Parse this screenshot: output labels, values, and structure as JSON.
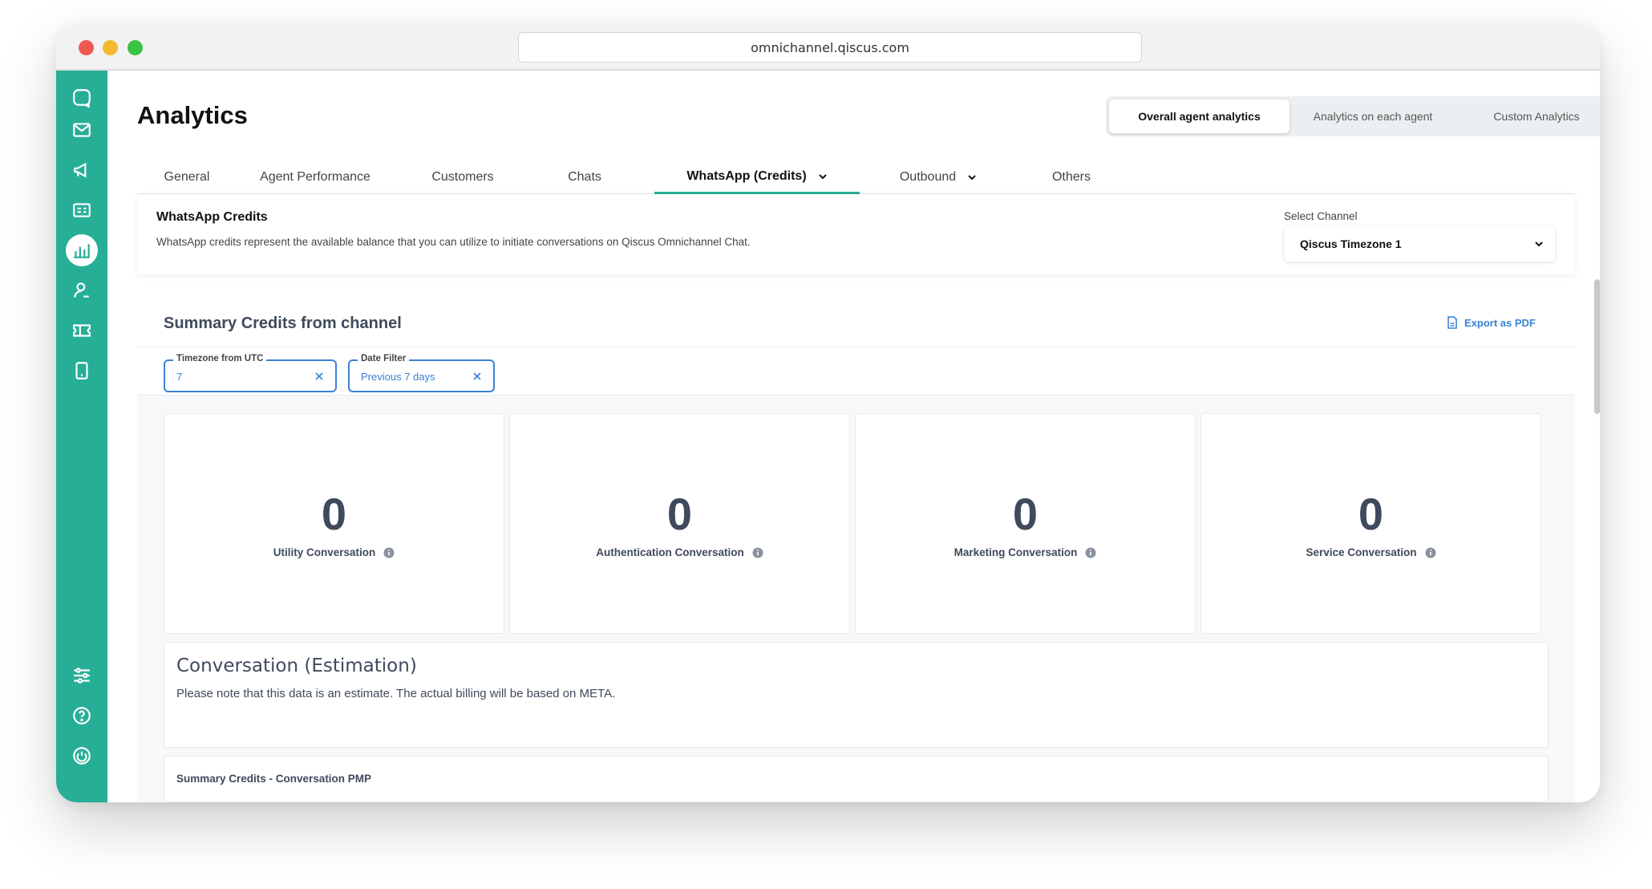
{
  "browser": {
    "url": "omnichannel.qiscus.com"
  },
  "sidebar": {
    "icons": [
      "chat-icon",
      "inbox-icon",
      "broadcast-icon",
      "contacts-icon",
      "analytics-icon",
      "agent-icon",
      "ticket-icon",
      "mobile-icon",
      "settings-icon",
      "help-icon",
      "power-icon"
    ],
    "active": "analytics-icon"
  },
  "header": {
    "title": "Analytics",
    "views": [
      "Overall agent analytics",
      "Analytics on each agent",
      "Custom Analytics"
    ],
    "active_view": "Overall agent analytics"
  },
  "tabs": [
    "General",
    "Agent Performance",
    "Customers",
    "Chats",
    "WhatsApp (Credits)",
    "Outbound",
    "Others"
  ],
  "active_tab": "WhatsApp (Credits)",
  "credits": {
    "title": "WhatsApp Credits",
    "description": "WhatsApp credits represent the available balance that you can utilize to initiate conversations on Qiscus Omnichannel Chat.",
    "channel_label": "Select Channel",
    "channel_value": "Qiscus Timezone 1"
  },
  "summary": {
    "title": "Summary Credits from channel",
    "export_label": "Export as PDF",
    "filters": [
      {
        "label": "Timezone from UTC",
        "value": "7"
      },
      {
        "label": "Date Filter",
        "value": "Previous 7 days"
      }
    ],
    "metrics": [
      {
        "value": "0",
        "label": "Utility Conversation"
      },
      {
        "value": "0",
        "label": "Authentication Conversation"
      },
      {
        "value": "0",
        "label": "Marketing Conversation"
      },
      {
        "value": "0",
        "label": "Service Conversation"
      }
    ]
  },
  "estimation": {
    "title": "Conversation (Estimation)",
    "note": "Please note that this data is an estimate. The actual billing will be based on META."
  },
  "pmp": {
    "title": "Summary Credits - Conversation PMP"
  },
  "colors": {
    "sidebar": "#27ae96",
    "accent": "#3b82d6",
    "text_dark": "#3f4a5c"
  }
}
